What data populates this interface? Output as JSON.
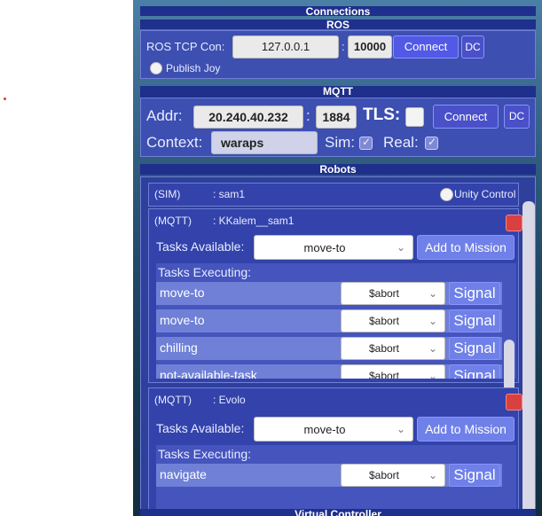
{
  "connections": {
    "title": "Connections"
  },
  "ros": {
    "title": "ROS",
    "tcp_label": "ROS TCP Con:",
    "ip": "127.0.0.1",
    "separator": ":",
    "port": "10000",
    "connect_label": "Connect",
    "dc_label": "DC",
    "publish_joy_label": "Publish Joy"
  },
  "mqtt": {
    "title": "MQTT",
    "addr_label": "Addr:",
    "addr": "20.240.40.232",
    "separator": ":",
    "port": "1884",
    "tls_label": "TLS:",
    "connect_label": "Connect",
    "dc_label": "DC",
    "context_label": "Context:",
    "context_value": "waraps",
    "sim_label": "Sim:",
    "sim_checked": true,
    "real_label": "Real:",
    "real_checked": true
  },
  "robots": {
    "title": "Robots",
    "sim_card": {
      "type": "(SIM)",
      "name": ": sam1",
      "unity_control_label": "Unity Control"
    },
    "cards": [
      {
        "type": "(MQTT)",
        "name": ": KKalem__sam1",
        "tasks_available_label": "Tasks Available:",
        "selected_task": "move-to",
        "add_to_mission_label": "Add to Mission",
        "tasks_executing_label": "Tasks Executing:",
        "tasks": [
          {
            "name": "move-to",
            "signal_value": "$abort",
            "signal_label": "Signal"
          },
          {
            "name": "move-to",
            "signal_value": "$abort",
            "signal_label": "Signal"
          },
          {
            "name": "chilling",
            "signal_value": "$abort",
            "signal_label": "Signal"
          },
          {
            "name": "not-available-task",
            "signal_value": "$abort",
            "signal_label": "Signal"
          }
        ]
      },
      {
        "type": "(MQTT)",
        "name": ": Evolo",
        "tasks_available_label": "Tasks Available:",
        "selected_task": "move-to",
        "add_to_mission_label": "Add to Mission",
        "tasks_executing_label": "Tasks Executing:",
        "tasks": [
          {
            "name": "navigate",
            "signal_value": "$abort",
            "signal_label": "Signal"
          }
        ]
      }
    ]
  },
  "virtual_controller": {
    "title": "Virtual Controller"
  },
  "colors": {
    "accent": "#5159e6",
    "section": "#3d4fb0",
    "header": "#1e2f8c",
    "status_red": "#d94040"
  }
}
